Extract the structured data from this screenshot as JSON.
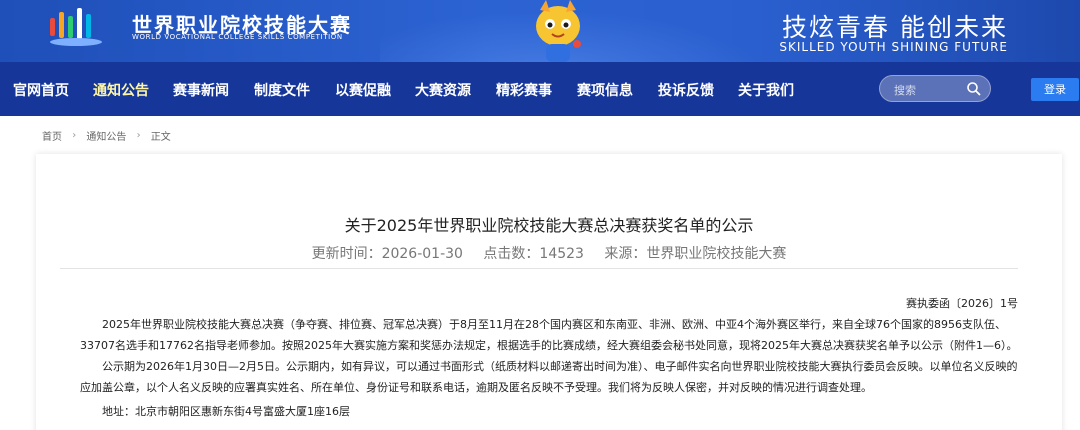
{
  "header": {
    "title": "世界职业院校技能大赛",
    "subtitle": "WORLD VOCATIONAL COLLEGE SKILLS COMPETITION",
    "slogan": "技炫青春  能创未来",
    "slogan_en": "SKILLED YOUTH SHINING FUTURE"
  },
  "nav": {
    "items": [
      "官网首页",
      "通知公告",
      "赛事新闻",
      "制度文件",
      "以赛促融",
      "大赛资源",
      "精彩赛事",
      "赛项信息",
      "投诉反馈",
      "关于我们"
    ],
    "active_index": 1,
    "search_placeholder": "搜索",
    "login_label": "登录"
  },
  "breadcrumb": [
    "首页",
    "通知公告",
    "正文"
  ],
  "article": {
    "title": "关于2025年世界职业院校技能大赛总决赛获奖名单的公示",
    "meta": {
      "updated": "更新时间：2026-01-30",
      "clicks": "点击数：14523",
      "source": "来源：世界职业院校技能大赛"
    },
    "doc_number": "赛执委函〔2026〕1号",
    "paragraphs": [
      "2025年世界职业院校技能大赛总决赛（争夺赛、排位赛、冠军总决赛）于8月至11月在28个国内赛区和东南亚、非洲、欧洲、中亚4个海外赛区举行，来自全球76个国家的8956支队伍、33707名选手和17762名指导老师参加。按照2025年大赛实施方案和奖惩办法规定，根据选手的比赛成绩，经大赛组委会秘书处同意，现将2025年大赛总决赛获奖名单予以公示（附件1—6）。",
      "公示期为2026年1月30日—2月5日。公示期内，如有异议，可以通过书面形式（纸质材料以邮递寄出时间为准）、电子邮件实名向世界职业院校技能大赛执行委员会反映。以单位名义反映的应加盖公章，以个人名义反映的应署真实姓名、所在单位、身份证号和联系电话，逾期及匿名反映不予受理。我们将为反映人保密，并对反映的情况进行调查处理。",
      "地址：北京市朝阳区惠新东街4号富盛大厦1座16层"
    ]
  },
  "colors": {
    "banner": "#2a5fcf",
    "nav": "#16369a",
    "nav_active": "#fff7a8",
    "login": "#2a7cf0"
  }
}
